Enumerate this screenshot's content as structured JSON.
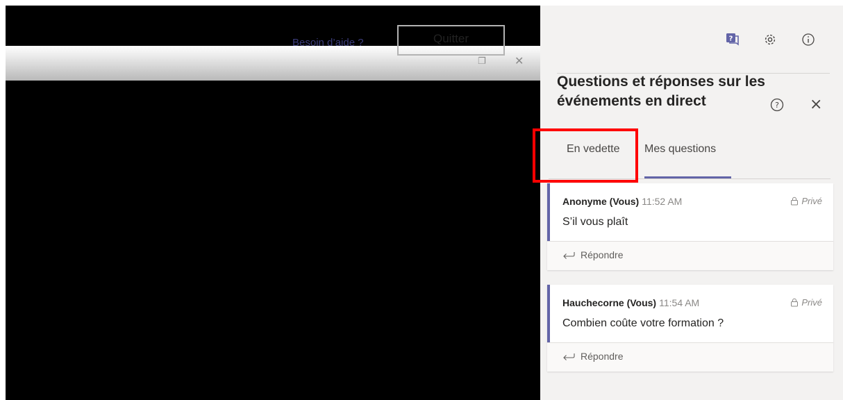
{
  "video": {
    "help_link": "Besoin d’aide ?",
    "quit_label": "Quitter"
  },
  "panel": {
    "title": "Questions et réponses sur les événements en direct",
    "tabs": [
      {
        "label": "En vedette",
        "active": false
      },
      {
        "label": "Mes questions",
        "active": true
      }
    ],
    "questions": [
      {
        "author": "Anonyme (Vous)",
        "time": "11:52 AM",
        "visibility": "Privé",
        "text": "S’il vous plaît",
        "reply_label": "Répondre"
      },
      {
        "author": "Hauchecorne (Vous)",
        "time": "11:54 AM",
        "visibility": "Privé",
        "text": "Combien coûte votre formation ?",
        "reply_label": "Répondre"
      }
    ]
  },
  "colors": {
    "accent": "#6264a7",
    "highlight": "#ff0000",
    "panel_bg": "#f3f2f1"
  }
}
